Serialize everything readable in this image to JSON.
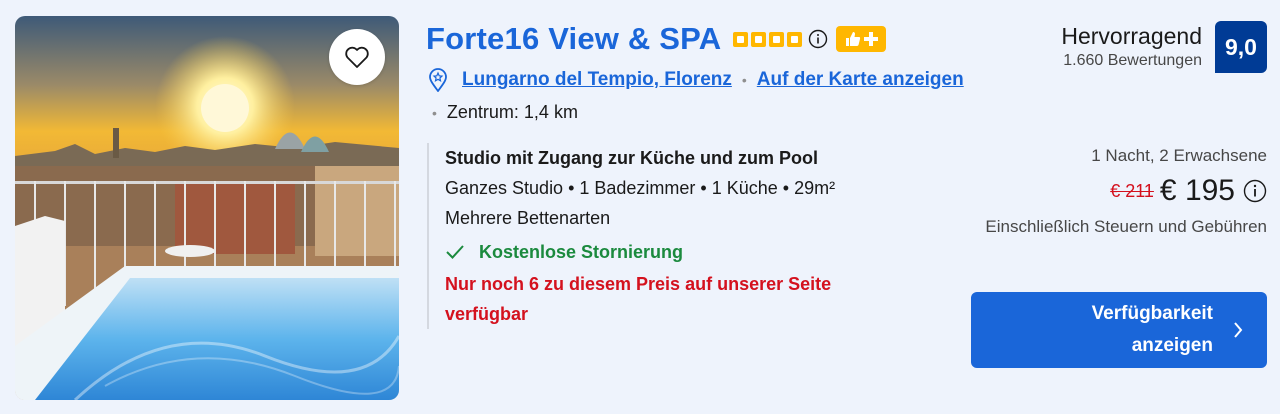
{
  "hotel": {
    "name": "Forte16 View & SPA",
    "stars": 4,
    "address_link": "Lungarno del Tempio, Florenz",
    "map_link": "Auf der Karte anzeigen",
    "distance": "Zentrum: 1,4 km"
  },
  "rating": {
    "word": "Hervorragend",
    "count": "1.660 Bewertungen",
    "score": "9,0"
  },
  "room": {
    "title": "Studio mit Zugang zur Küche und zum Pool",
    "details": "Ganzes Studio • 1 Badezimmer • 1 Küche • 29m²",
    "beds": "Mehrere Bettenarten",
    "cancellation": "Kostenlose Stornierung",
    "scarcity": "Nur noch 6 zu diesem Preis auf unserer Seite verfügbar"
  },
  "price": {
    "occupancy": "1 Nacht, 2 Erwachsene",
    "old": "€ 211",
    "current": "€ 195",
    "taxes": "Einschließlich Steuern und Gebühren"
  },
  "cta": {
    "label": "Verfügbarkeit anzeigen"
  },
  "colors": {
    "brand_blue": "#1a66d9",
    "score_blue": "#003b95",
    "star_yellow": "#ffb700",
    "success_green": "#1b8a3e",
    "alert_red": "#d4111e"
  },
  "icons": [
    "heart-icon",
    "star-icon",
    "info-icon",
    "thumbs-up-icon",
    "plus-icon",
    "location-pin-icon",
    "checkmark-icon",
    "chevron-right-icon"
  ]
}
